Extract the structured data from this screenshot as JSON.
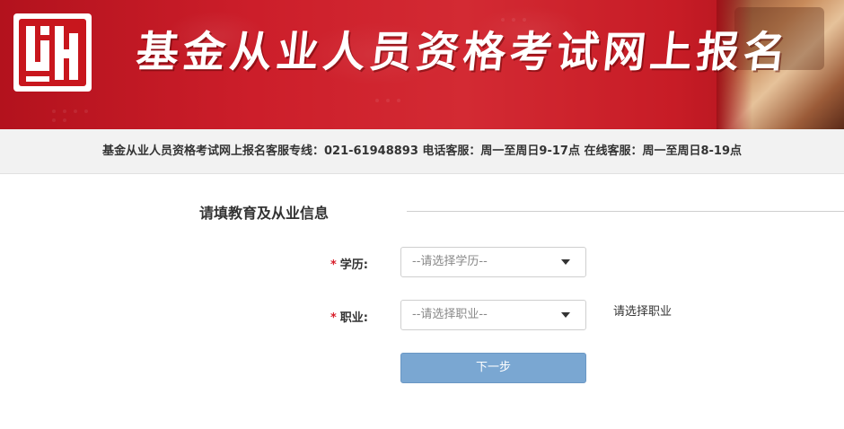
{
  "banner": {
    "title": "基金从业人员资格考试网上报名",
    "logo_icon": "seal-logo-icon",
    "colors": {
      "banner_red": "#cc1e2a",
      "title_text": "#ffffff"
    }
  },
  "hotline": {
    "text": "基金从业人员资格考试网上报名客服专线：021-61948893 电话客服：周一至周日9-17点 在线客服：周一至周日8-19点"
  },
  "form": {
    "section_title": "请填教育及从业信息",
    "required_mark": "*",
    "education": {
      "label": "学历:",
      "placeholder": "--请选择学历--"
    },
    "occupation": {
      "label": "职业:",
      "placeholder": "--请选择职业--",
      "hint": "请选择职业"
    },
    "next_button": "下一步",
    "colors": {
      "required": "#d81e2a",
      "button": "#7aa7d2"
    }
  }
}
